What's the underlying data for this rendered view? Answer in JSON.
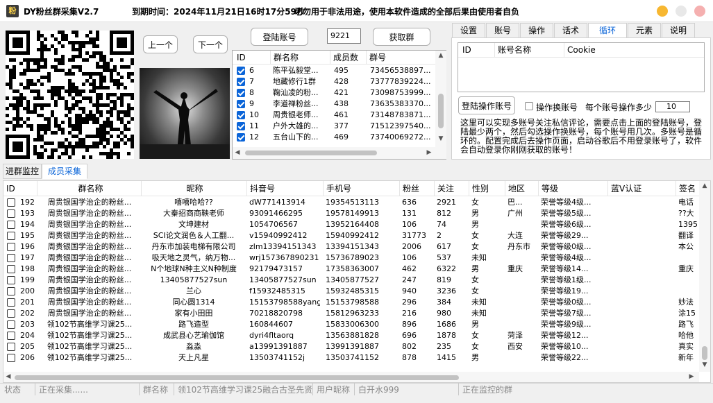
{
  "titlebar": {
    "icon": "粉",
    "app_title": "DY粉丝群采集V2.7",
    "expiry": "到期时间：2024年11月21日16时17分59秒",
    "warning": "切勿用于非法用途，使用本软件造成的全部后果由使用者自负",
    "colors": {
      "min": "#f7b731",
      "max": "#e8e8e8",
      "close": "#f0a0a0"
    }
  },
  "left_controls": {
    "prev": "上一个",
    "next": "下一个",
    "login": "登陆账号",
    "number_value": "9221",
    "get_group": "获取群"
  },
  "group_list": {
    "headers": [
      "ID",
      "群名称",
      "成员数",
      "群号"
    ],
    "rows": [
      {
        "id": "6",
        "name": "陈平弘毅堂...",
        "count": "495",
        "group_no": "73456538897..."
      },
      {
        "id": "7",
        "name": "地藏修行1群",
        "count": "428",
        "group_no": "73777839224..."
      },
      {
        "id": "8",
        "name": "鞠汕凌的粉...",
        "count": "421",
        "group_no": "73098753999..."
      },
      {
        "id": "9",
        "name": "李道禅粉丝...",
        "count": "438",
        "group_no": "73635383370..."
      },
      {
        "id": "10",
        "name": "周贵银老师...",
        "count": "461",
        "group_no": "73148783871..."
      },
      {
        "id": "11",
        "name": "户外大雄的...",
        "count": "377",
        "group_no": "71512397540..."
      },
      {
        "id": "12",
        "name": "五台山下的...",
        "count": "469",
        "group_no": "73740069272..."
      }
    ]
  },
  "right_tabs": [
    "设置",
    "账号",
    "操作",
    "话术",
    "循环",
    "元素",
    "说明"
  ],
  "account_table": {
    "headers": [
      "ID",
      "账号名称",
      "Cookie"
    ]
  },
  "loop_panel": {
    "login_button": "登陆操作账号",
    "switch_label": "操作换账号",
    "per_account_label": "每个账号操作多少",
    "per_account_value": "10",
    "help_text": "这里可以实现多账号关注私信评论，需要点击上面的登陆账号，登陆最少两个，然后勾选操作换账号，每个账号用几次。多账号是循环的。配置完成后去操作页面，启动谷歌后不用登录账号了，软件会自动登录你刚刚获取的账号！"
  },
  "bottom_tabs": [
    "进群监控",
    "成员采集"
  ],
  "member_table": {
    "headers": [
      "ID",
      "群名称",
      "昵称",
      "抖音号",
      "手机号",
      "粉丝",
      "关注",
      "性别",
      "地区",
      "等级",
      "蓝V认证",
      "签名"
    ],
    "rows": [
      {
        "id": "192",
        "group": "周贵银国学治企的粉丝...",
        "nick": "嘻嘻哈哈??",
        "dy": "dW771413914",
        "phone": "19354513113",
        "fans": "636",
        "follow": "2921",
        "sex": "女",
        "region": "巴...",
        "level": "荣誉等级4级...",
        "bluev": "",
        "sign": "电话"
      },
      {
        "id": "193",
        "group": "周贵银国学治企的粉丝...",
        "nick": "大秦招商商鞅老师",
        "dy": "93091466295",
        "phone": "19578149913",
        "fans": "131",
        "follow": "812",
        "sex": "男",
        "region": "广州",
        "level": "荣誉等级5级...",
        "bluev": "",
        "sign": "??大"
      },
      {
        "id": "194",
        "group": "周贵银国学治企的粉丝...",
        "nick": "文坤建材",
        "dy": "1054706567",
        "phone": "13952164408",
        "fans": "106",
        "follow": "74",
        "sex": "男",
        "region": "",
        "level": "荣誉等级6级...",
        "bluev": "",
        "sign": "1395"
      },
      {
        "id": "195",
        "group": "周贵银国学治企的粉丝...",
        "nick": "SCI论文润色＆人工翻...",
        "dy": "v15940992412",
        "phone": "15940992412",
        "fans": "31773",
        "follow": "2",
        "sex": "女",
        "region": "大连",
        "level": "荣誉等级29...",
        "bluev": "",
        "sign": "翻译"
      },
      {
        "id": "196",
        "group": "周贵银国学治企的粉丝...",
        "nick": "丹东市加装电梯有限公司",
        "dy": "zlm13394151343",
        "phone": "13394151343",
        "fans": "2006",
        "follow": "617",
        "sex": "女",
        "region": "丹东市",
        "level": "荣誉等级0级...",
        "bluev": "",
        "sign": "本公"
      },
      {
        "id": "197",
        "group": "周贵银国学治企的粉丝...",
        "nick": "吸天地之灵气，纳万物...",
        "dy": "wrj157367890231",
        "phone": "15736789023",
        "fans": "106",
        "follow": "537",
        "sex": "未知",
        "region": "",
        "level": "荣誉等级4级...",
        "bluev": "",
        "sign": ""
      },
      {
        "id": "198",
        "group": "周贵银国学治企的粉丝...",
        "nick": "N个地球N种主义N种制度",
        "dy": "92179473157",
        "phone": "17358363007",
        "fans": "462",
        "follow": "6322",
        "sex": "男",
        "region": "重庆",
        "level": "荣誉等级14...",
        "bluev": "",
        "sign": "重庆"
      },
      {
        "id": "199",
        "group": "周贵银国学治企的粉丝...",
        "nick": "13405877527sun",
        "dy": "13405877527sun",
        "phone": "13405877527",
        "fans": "247",
        "follow": "819",
        "sex": "女",
        "region": "",
        "level": "荣誉等级1级...",
        "bluev": "",
        "sign": ""
      },
      {
        "id": "200",
        "group": "周贵银国学治企的粉丝...",
        "nick": "兰心",
        "dy": "f15932485315",
        "phone": "15932485315",
        "fans": "940",
        "follow": "3236",
        "sex": "女",
        "region": "",
        "level": "荣誉等级19...",
        "bluev": "",
        "sign": ""
      },
      {
        "id": "201",
        "group": "周贵银国学治企的粉丝...",
        "nick": "同心圆1314",
        "dy": "15153798588yang",
        "phone": "15153798588",
        "fans": "296",
        "follow": "384",
        "sex": "未知",
        "region": "",
        "level": "荣誉等级0级...",
        "bluev": "",
        "sign": "妙法"
      },
      {
        "id": "202",
        "group": "周贵银国学治企的粉丝...",
        "nick": "家有小田田",
        "dy": "70218820798",
        "phone": "15812963233",
        "fans": "216",
        "follow": "980",
        "sex": "未知",
        "region": "",
        "level": "荣誉等级7级...",
        "bluev": "",
        "sign": "涂15"
      },
      {
        "id": "203",
        "group": "领102节高维学习课25...",
        "nick": "路飞造型",
        "dy": "160844607",
        "phone": "15833006300",
        "fans": "896",
        "follow": "1686",
        "sex": "男",
        "region": "",
        "level": "荣誉等级9级...",
        "bluev": "",
        "sign": "路飞"
      },
      {
        "id": "204",
        "group": "领102节高维学习课25...",
        "nick": "成武县心艺瑜伽馆",
        "dy": "dyri4fltaorq",
        "phone": "13563881828",
        "fans": "696",
        "follow": "1878",
        "sex": "女",
        "region": "菏泽",
        "level": "荣誉等级12...",
        "bluev": "",
        "sign": "哈他"
      },
      {
        "id": "205",
        "group": "领102节高维学习课25...",
        "nick": "淼淼",
        "dy": "a13991391887",
        "phone": "13991391887",
        "fans": "802",
        "follow": "235",
        "sex": "女",
        "region": "西安",
        "level": "荣誉等级10...",
        "bluev": "",
        "sign": "真实"
      },
      {
        "id": "206",
        "group": "领102节高维学习课25...",
        "nick": "天上凡星",
        "dy": "13503741152j",
        "phone": "13503741152",
        "fans": "878",
        "follow": "1415",
        "sex": "男",
        "region": "",
        "level": "荣誉等级22...",
        "bluev": "",
        "sign": "新年"
      }
    ]
  },
  "statusbar": {
    "status_label": "状态",
    "status_value": "正在采集......",
    "group_label": "群名称",
    "group_value": "领102节高维学习课25融合古圣先贤",
    "user_label": "用户昵称",
    "user_value": "白开水999",
    "monitor": "正在监控的群"
  }
}
